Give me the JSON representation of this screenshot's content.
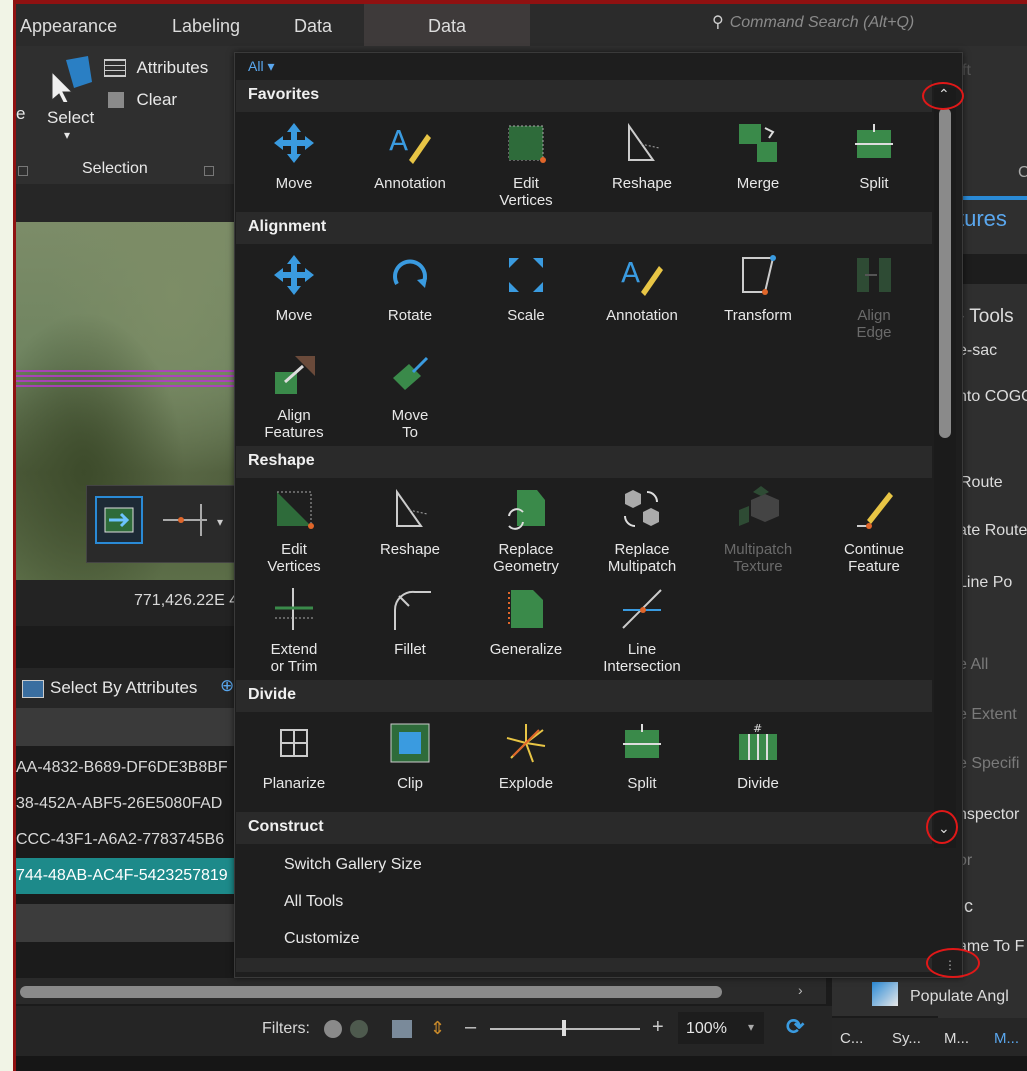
{
  "ribbon": {
    "tabs": [
      "Appearance",
      "Labeling",
      "Data",
      "Data"
    ],
    "command_search": "Command Search (Alt+Q)",
    "select_label": "Select",
    "attributes_label": "Attributes",
    "clear_label": "Clear",
    "selection_group": "Selection",
    "partial_e": "e",
    "partial_ft": "ft",
    "partial_c": "C"
  },
  "map": {
    "coordinate": "771,426.22E 4"
  },
  "table": {
    "select_by_attributes": "Select By Attributes",
    "rows": [
      "AA-4832-B689-DF6DE3B8BF",
      "38-452A-ABF5-26E5080FAD",
      "CCC-43F1-A6A2-7783745B6",
      "744-48AB-AC4F-5423257819"
    ]
  },
  "status": {
    "filters_label": "Filters:",
    "zoom": "100%"
  },
  "right_panel": {
    "tures": "tures",
    "tools": "Tools",
    "items": [
      "e-sac",
      "nto COGO",
      "Route",
      "ate Route",
      "Line Po",
      "e All",
      "e Extent",
      "e Specifi",
      "nspector",
      "or",
      "ic",
      "ame To F"
    ],
    "populate": "Populate Angl",
    "bottom_tabs": [
      "C...",
      "Sy...",
      "M...",
      "M..."
    ]
  },
  "gallery": {
    "filter": "All",
    "sections": {
      "favorites": {
        "title": "Favorites",
        "tools": [
          {
            "label": "Move"
          },
          {
            "label": "Annotation"
          },
          {
            "label": "Edit\nVertices"
          },
          {
            "label": "Reshape"
          },
          {
            "label": "Merge"
          },
          {
            "label": "Split"
          }
        ]
      },
      "alignment": {
        "title": "Alignment",
        "tools": [
          {
            "label": "Move"
          },
          {
            "label": "Rotate"
          },
          {
            "label": "Scale"
          },
          {
            "label": "Annotation"
          },
          {
            "label": "Transform"
          },
          {
            "label": "Align\nEdge"
          },
          {
            "label": "Align\nFeatures"
          },
          {
            "label": "Move\nTo"
          }
        ]
      },
      "reshape": {
        "title": "Reshape",
        "tools": [
          {
            "label": "Edit\nVertices"
          },
          {
            "label": "Reshape"
          },
          {
            "label": "Replace\nGeometry"
          },
          {
            "label": "Replace\nMultipatch"
          },
          {
            "label": "Multipatch\nTexture"
          },
          {
            "label": "Continue\nFeature"
          },
          {
            "label": "Extend\nor Trim"
          },
          {
            "label": "Fillet"
          },
          {
            "label": "Generalize"
          },
          {
            "label": "Line\nIntersection"
          }
        ]
      },
      "divide": {
        "title": "Divide",
        "tools": [
          {
            "label": "Planarize"
          },
          {
            "label": "Clip"
          },
          {
            "label": "Explode"
          },
          {
            "label": "Split"
          },
          {
            "label": "Divide"
          }
        ]
      },
      "construct": {
        "title": "Construct"
      }
    },
    "menu": [
      "Switch Gallery Size",
      "All Tools",
      "Customize"
    ]
  }
}
